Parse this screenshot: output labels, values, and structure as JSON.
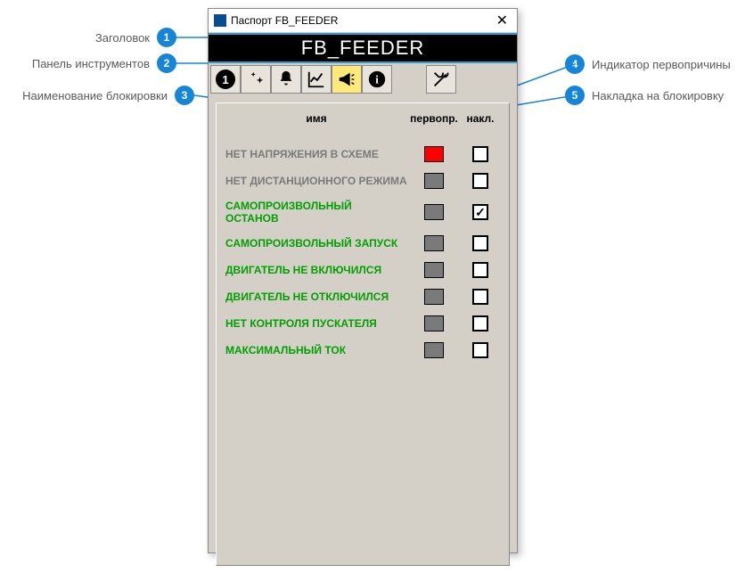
{
  "titlebar": {
    "title": "Паспорт FB_FEEDER",
    "close": "✕"
  },
  "header": {
    "title": "FB_FEEDER"
  },
  "toolbar": {
    "active_index": 4
  },
  "columns": {
    "name": "имя",
    "first": "первопр.",
    "overlay": "накл."
  },
  "rows": [
    {
      "label": "НЕТ НАПРЯЖЕНИЯ В СХЕМЕ",
      "style": "gray",
      "indicator": "red",
      "checked": false
    },
    {
      "label": "НЕТ ДИСТАНЦИОННОГО РЕЖИМА",
      "style": "gray",
      "indicator": "gray",
      "checked": false
    },
    {
      "label": "САМОПРОИЗВОЛЬНЫЙ ОСТАНОВ",
      "style": "green",
      "indicator": "gray",
      "checked": true
    },
    {
      "label": "САМОПРОИЗВОЛЬНЫЙ ЗАПУСК",
      "style": "green",
      "indicator": "gray",
      "checked": false
    },
    {
      "label": "ДВИГАТЕЛЬ НЕ ВКЛЮЧИЛСЯ",
      "style": "green",
      "indicator": "gray",
      "checked": false
    },
    {
      "label": "ДВИГАТЕЛЬ НЕ ОТКЛЮЧИЛСЯ",
      "style": "green",
      "indicator": "gray",
      "checked": false
    },
    {
      "label": "НЕТ КОНТРОЛЯ ПУСКАТЕЛЯ",
      "style": "green",
      "indicator": "gray",
      "checked": false
    },
    {
      "label": "МАКСИМАЛЬНЫЙ ТОК",
      "style": "green",
      "indicator": "gray",
      "checked": false
    }
  ],
  "callouts": {
    "c1": {
      "num": "1",
      "text": "Заголовок"
    },
    "c2": {
      "num": "2",
      "text": "Панель инструментов"
    },
    "c3": {
      "num": "3",
      "text": "Наименование блокировки"
    },
    "c4": {
      "num": "4",
      "text": "Индикатор первопричины"
    },
    "c5": {
      "num": "5",
      "text": "Накладка на блокировку"
    }
  }
}
